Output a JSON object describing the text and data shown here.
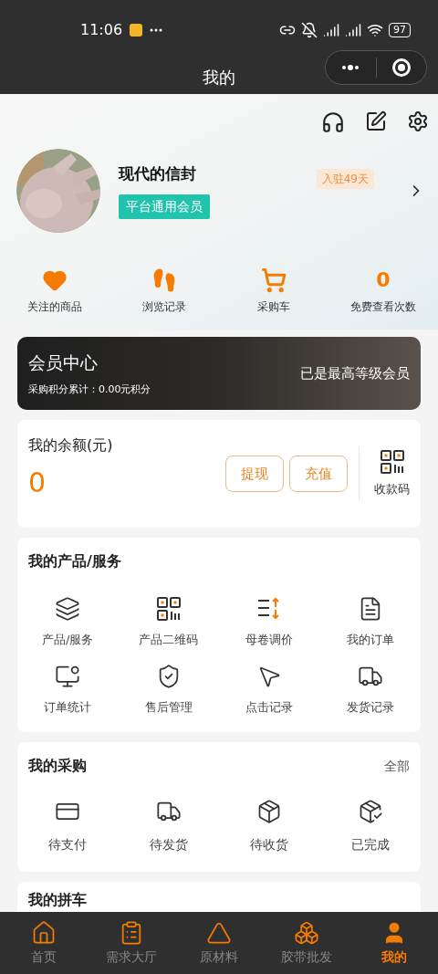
{
  "status_bar": {
    "time": "11:06",
    "battery": "97"
  },
  "nav": {
    "title": "我的"
  },
  "profile": {
    "name": "现代的信封",
    "member_badge": "平台通用会员",
    "days_badge": "入驻49天"
  },
  "shortcuts": [
    {
      "kind": "icon",
      "label": "关注的商品"
    },
    {
      "kind": "icon",
      "label": "浏览记录"
    },
    {
      "kind": "icon",
      "label": "采购车"
    },
    {
      "kind": "count",
      "value": "0",
      "label": "免费查看次数"
    }
  ],
  "member_center": {
    "title": "会员中心",
    "points": "采购积分累计：0.00元积分",
    "level_text": "已是最高等级会员"
  },
  "balance": {
    "title": "我的余额(元)",
    "amount": "0",
    "buttons": [
      "提现",
      "充值"
    ],
    "qr_label": "收款码"
  },
  "products": {
    "title": "我的产品/服务",
    "items": [
      "产品/服务",
      "产品二维码",
      "母卷调价",
      "我的订单",
      "订单统计",
      "售后管理",
      "点击记录",
      "发货记录"
    ]
  },
  "purchases": {
    "title": "我的采购",
    "all_link": "全部",
    "items": [
      "待支付",
      "待发货",
      "待收货",
      "已完成"
    ]
  },
  "carpool": {
    "title": "我的拼车"
  },
  "tab_bar": [
    {
      "label": "首页",
      "selected": false
    },
    {
      "label": "需求大厅",
      "selected": false
    },
    {
      "label": "原材料",
      "selected": false
    },
    {
      "label": "胶带批发",
      "selected": false
    },
    {
      "label": "我的",
      "selected": true
    }
  ]
}
